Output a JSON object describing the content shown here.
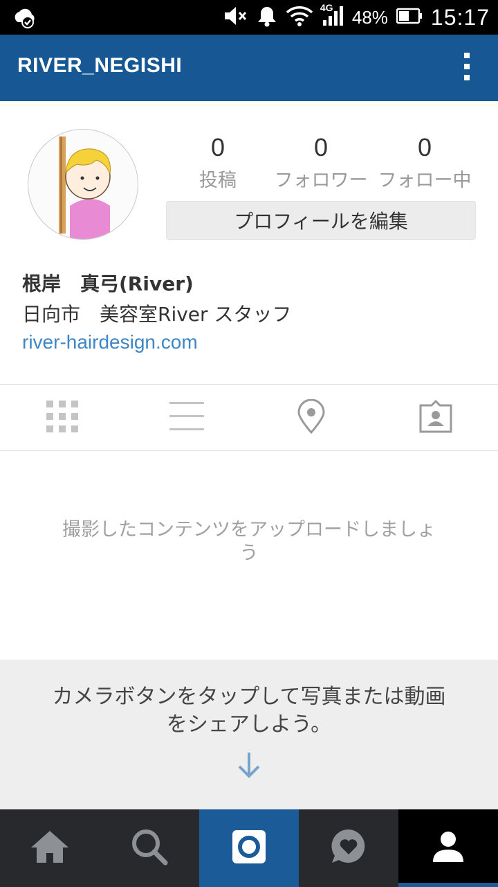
{
  "status_bar": {
    "battery_percent": "48%",
    "time": "15:17",
    "network": "4G"
  },
  "header": {
    "username": "RIVER_NEGISHI"
  },
  "profile": {
    "stats": [
      {
        "value": "0",
        "label": "投稿"
      },
      {
        "value": "0",
        "label": "フォロワー"
      },
      {
        "value": "0",
        "label": "フォロー中"
      }
    ],
    "edit_button_label": "プロフィールを編集",
    "full_name": "根岸　真弓(River)",
    "bio": "日向市　美容室River スタッフ",
    "website": "river-hairdesign.com"
  },
  "view_tabs": [
    {
      "icon": "grid-icon"
    },
    {
      "icon": "list-icon"
    },
    {
      "icon": "location-pin-icon"
    },
    {
      "icon": "tagged-person-icon"
    }
  ],
  "empty_state": {
    "message": "撮影したコンテンツをアップロードしましょう"
  },
  "promo": {
    "text": "カメラボタンをタップして写真または動画をシェアしよう。"
  },
  "bottom_nav": [
    {
      "icon": "home-icon"
    },
    {
      "icon": "search-icon"
    },
    {
      "icon": "camera-icon"
    },
    {
      "icon": "activity-heart-icon"
    },
    {
      "icon": "profile-icon"
    }
  ],
  "colors": {
    "header": "#175894",
    "link": "#3f86c6",
    "nav_background": "#27292c",
    "nav_active": "#1b5b98"
  }
}
